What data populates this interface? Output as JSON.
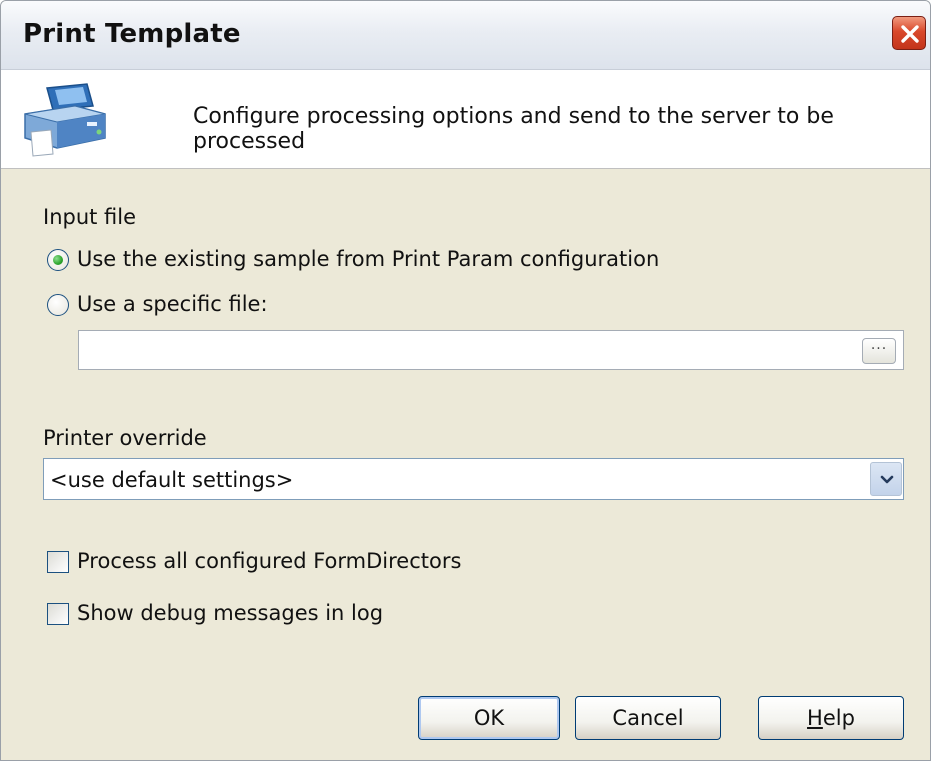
{
  "window": {
    "title": "Print Template",
    "close_icon": "close-icon"
  },
  "header": {
    "icon": "printer-icon",
    "description": "Configure processing options and send to the server to be processed"
  },
  "input_file": {
    "label": "Input file",
    "option_existing": "Use the existing sample from Print Param configuration",
    "option_specific": "Use a specific file:",
    "selected": "existing",
    "file_value": "",
    "browse_label": "···"
  },
  "printer": {
    "label": "Printer override",
    "selected": "<use default settings>"
  },
  "options": {
    "process_all": "Process all configured FormDirectors",
    "process_all_checked": false,
    "show_debug": "Show debug messages in log",
    "show_debug_checked": false
  },
  "buttons": {
    "ok": "OK",
    "cancel": "Cancel",
    "help_mnemonic": "H",
    "help_rest": "elp"
  },
  "colors": {
    "close_button": "#d9482b",
    "radio_selected": "#2ea52e",
    "control_border": "#1c5180",
    "dialog_background": "#ece9d8"
  }
}
